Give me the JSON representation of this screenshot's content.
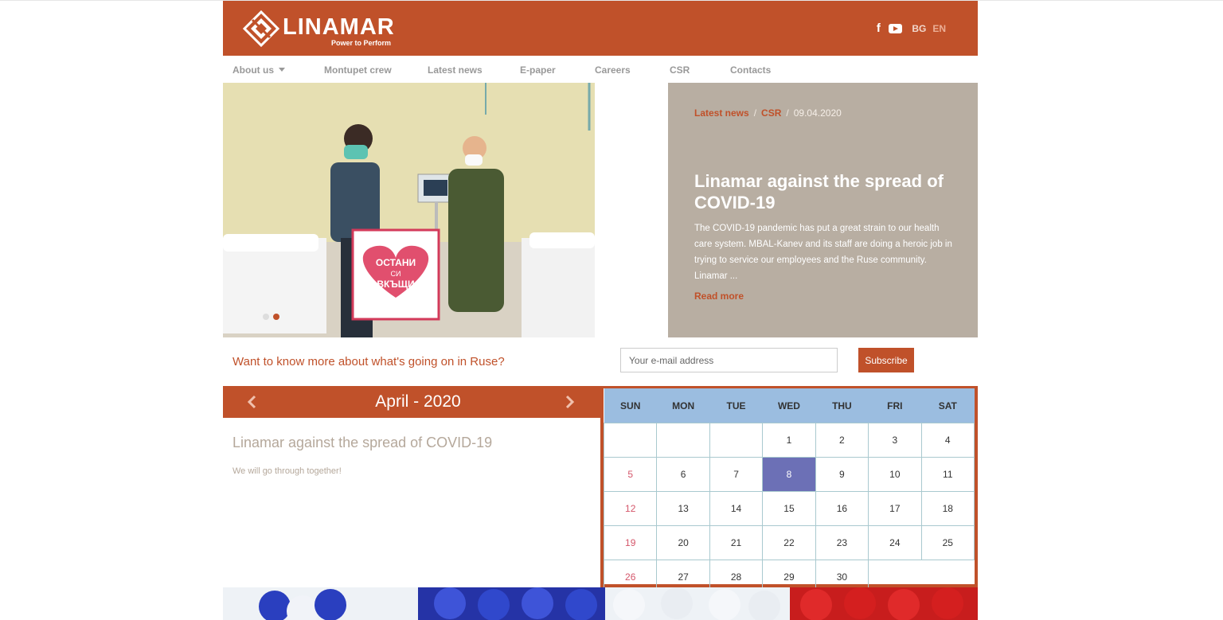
{
  "header": {
    "logo_text": "LINAMAR",
    "logo_tagline": "Power to Perform",
    "social": {
      "facebook_icon": "f",
      "youtube_icon": "youtube-icon"
    },
    "languages": [
      "BG",
      "EN"
    ]
  },
  "nav": {
    "items": [
      "About us",
      "Montupet crew",
      "Latest news",
      "E-paper",
      "Careers",
      "CSR",
      "Contacts"
    ]
  },
  "hero": {
    "sign_line1": "ОСТАНИ",
    "sign_line2": "СИ",
    "sign_line3": "ВКЪЩИ",
    "slides_count": 2,
    "active_slide": 2,
    "breadcrumb": {
      "cat1": "Latest news",
      "sep": "/",
      "cat2": "CSR",
      "date": "09.04.2020"
    },
    "title": "Linamar against the spread of COVID-19",
    "text": "The COVID-19 pandemic has put a great strain to our health care system. MBAL-Kanev and its staff are doing a heroic job in trying to service our employees and the Ruse community. Linamar ...",
    "read_more": "Read more"
  },
  "subscribe": {
    "question": "Want to know more about what's going on in Ruse?",
    "placeholder": "Your e-mail address",
    "button": "Subscribe"
  },
  "calendar": {
    "month_label": "April - 2020",
    "event_title": "Linamar against the spread of COVID-19",
    "event_subtitle": "We will go through together!",
    "weekdays": [
      "SUN",
      "MON",
      "TUE",
      "WED",
      "THU",
      "FRI",
      "SAT"
    ],
    "weeks": [
      [
        "",
        "",
        "",
        "1",
        "2",
        "3",
        "4"
      ],
      [
        "5",
        "6",
        "7",
        "8",
        "9",
        "10",
        "11"
      ],
      [
        "12",
        "13",
        "14",
        "15",
        "16",
        "17",
        "18"
      ],
      [
        "19",
        "20",
        "21",
        "22",
        "23",
        "24",
        "25"
      ],
      [
        "26",
        "27",
        "28",
        "29",
        "30",
        "",
        ""
      ]
    ],
    "highlighted_day": "8",
    "colors": {
      "accent": "#c0512a",
      "header_bg": "#9bbde0",
      "today": "#6c70b6",
      "sunday": "#d4566a"
    }
  }
}
